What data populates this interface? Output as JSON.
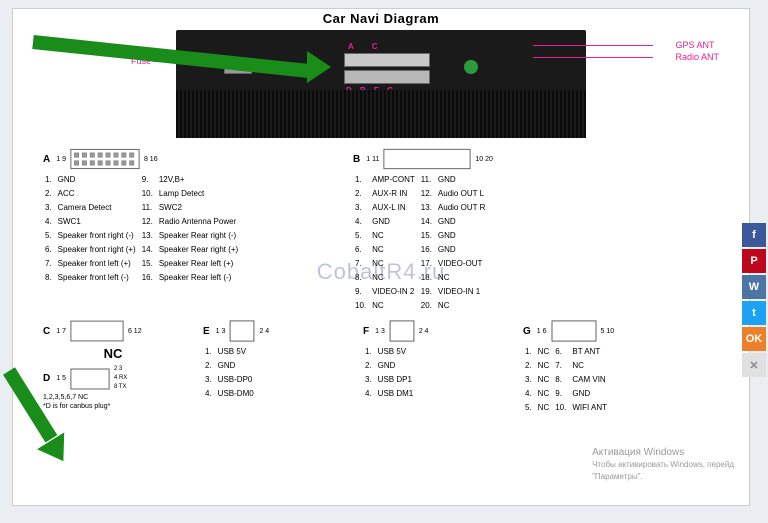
{
  "title": "Car Navi Diagram",
  "watermark": "CobaltR4.ru",
  "labels": {
    "fuse": "Fuse",
    "gps_ant": "GPS ANT",
    "radio_ant": "Radio ANT",
    "top_letters": "A          C",
    "bottom_letters": "D  B F  G"
  },
  "connectors": {
    "A": {
      "letter": "A",
      "pin_range_left": "1\n9",
      "pin_range_right": "8\n16",
      "pins_left": [
        {
          "n": "1.",
          "name": "GND"
        },
        {
          "n": "2.",
          "name": "ACC"
        },
        {
          "n": "3.",
          "name": "Camera Detect"
        },
        {
          "n": "4.",
          "name": "SWC1"
        },
        {
          "n": "5.",
          "name": "Speaker front right (-)"
        },
        {
          "n": "6.",
          "name": "Speaker front right (+)"
        },
        {
          "n": "7.",
          "name": "Speaker front left (+)"
        },
        {
          "n": "8.",
          "name": "Speaker front left (-)"
        }
      ],
      "pins_right": [
        {
          "n": "9.",
          "name": "12V,B+"
        },
        {
          "n": "10.",
          "name": "Lamp Detect"
        },
        {
          "n": "11.",
          "name": "SWC2"
        },
        {
          "n": "12.",
          "name": "Radio Antenna Power"
        },
        {
          "n": "13.",
          "name": "Speaker Rear right (-)"
        },
        {
          "n": "14.",
          "name": "Speaker Rear right (+)"
        },
        {
          "n": "15.",
          "name": "Speaker Rear left (+)"
        },
        {
          "n": "16.",
          "name": "Speaker Rear left (-)"
        }
      ]
    },
    "B": {
      "letter": "B",
      "pin_range_left": "1\n11",
      "pin_range_right": "10\n20",
      "pins_left": [
        {
          "n": "1.",
          "name": "AMP-CONT"
        },
        {
          "n": "2.",
          "name": "AUX-R IN"
        },
        {
          "n": "3.",
          "name": "AUX-L IN"
        },
        {
          "n": "4.",
          "name": "GND"
        },
        {
          "n": "5.",
          "name": "NC"
        },
        {
          "n": "6.",
          "name": "NC"
        },
        {
          "n": "7.",
          "name": "NC"
        },
        {
          "n": "8.",
          "name": "NC"
        },
        {
          "n": "9.",
          "name": "VIDEO-IN 2"
        },
        {
          "n": "10.",
          "name": "NC"
        }
      ],
      "pins_right": [
        {
          "n": "11.",
          "name": "GND"
        },
        {
          "n": "12.",
          "name": "Audio OUT  L"
        },
        {
          "n": "13.",
          "name": "Audio OUT  R"
        },
        {
          "n": "14.",
          "name": "GND"
        },
        {
          "n": "15.",
          "name": "GND"
        },
        {
          "n": "16.",
          "name": "GND"
        },
        {
          "n": "17.",
          "name": "VIDEO-OUT"
        },
        {
          "n": "18.",
          "name": "NC"
        },
        {
          "n": "19.",
          "name": "VIDEO-IN 1"
        },
        {
          "n": "20.",
          "name": "NC"
        }
      ]
    },
    "C": {
      "letter": "C",
      "pin_range_left": "1\n7",
      "pin_range_right": "6\n12",
      "nc_label": "NC"
    },
    "D": {
      "letter": "D",
      "pin_range_left": "1\n5",
      "pin_range_right_top": "2 3",
      "pin_range_rx": "4 RX",
      "pin_range_tx": "8 TX",
      "note1": "1,2,3,5,6,7   NC",
      "note2": "*D is for canbus plug*"
    },
    "E": {
      "letter": "E",
      "pin_range_left": "1\n3",
      "pin_range_right": "2\n4",
      "pins": [
        {
          "n": "1.",
          "name": "USB 5V"
        },
        {
          "n": "2.",
          "name": "GND"
        },
        {
          "n": "3.",
          "name": "USB-DP0"
        },
        {
          "n": "4.",
          "name": "USB-DM0"
        }
      ]
    },
    "F": {
      "letter": "F",
      "pin_range_left": "1\n3",
      "pin_range_right": "2\n4",
      "pins": [
        {
          "n": "1.",
          "name": "USB 5V"
        },
        {
          "n": "2.",
          "name": "GND"
        },
        {
          "n": "3.",
          "name": "USB DP1"
        },
        {
          "n": "4.",
          "name": "USB DM1"
        }
      ]
    },
    "G": {
      "letter": "G",
      "pin_range_left": "1\n6",
      "pin_range_right": "5\n10",
      "pins_left": [
        {
          "n": "1.",
          "name": "NC"
        },
        {
          "n": "2.",
          "name": "NC"
        },
        {
          "n": "3.",
          "name": "NC"
        },
        {
          "n": "4.",
          "name": "NC"
        },
        {
          "n": "5.",
          "name": "NC"
        }
      ],
      "pins_right": [
        {
          "n": "6.",
          "name": "BT ANT"
        },
        {
          "n": "7.",
          "name": "NC"
        },
        {
          "n": "8.",
          "name": "CAM VIN"
        },
        {
          "n": "9.",
          "name": "GND"
        },
        {
          "n": "10.",
          "name": "WIFI ANT"
        }
      ]
    }
  },
  "windows": {
    "line1": "Активация Windows",
    "line2": "Чтобы активировать Windows, перейд",
    "line3": "\"Параметры\"."
  },
  "social": {
    "fb": "f",
    "pin": "P",
    "vk": "W",
    "tw": "t",
    "ok": "OK",
    "x": "✕"
  }
}
